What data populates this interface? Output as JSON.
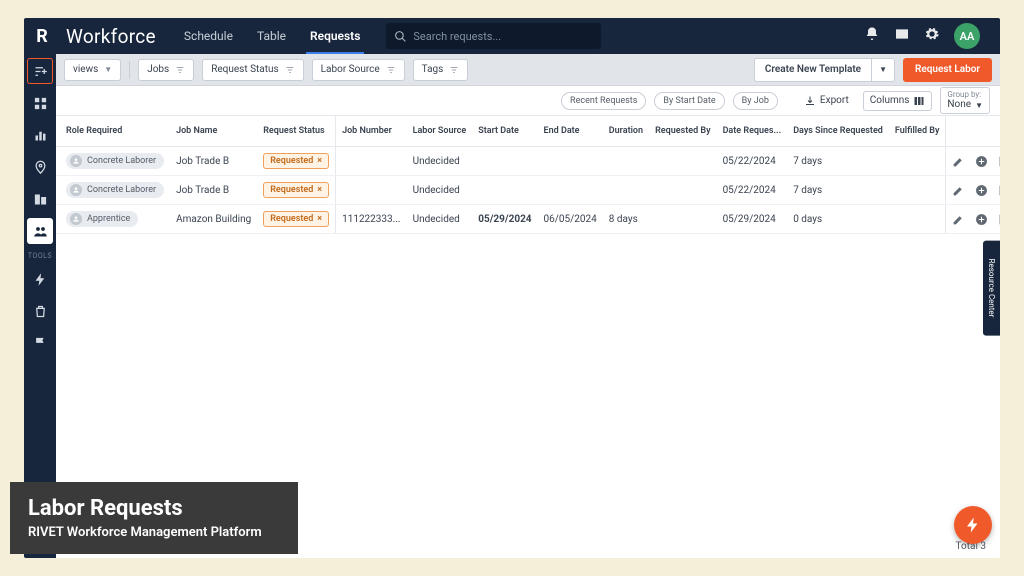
{
  "app": {
    "logo": "R",
    "title": "Workforce",
    "avatar": "AA"
  },
  "tabs": [
    {
      "label": "Schedule"
    },
    {
      "label": "Table"
    },
    {
      "label": "Requests",
      "active": true
    }
  ],
  "search": {
    "placeholder": "Search requests..."
  },
  "filterBar": {
    "views": "views",
    "chips": [
      "Jobs",
      "Request Status",
      "Labor Source",
      "Tags"
    ],
    "createTemplate": "Create New Template",
    "requestLabor": "Request Labor"
  },
  "toolbar": {
    "pills": [
      "Recent Requests",
      "By Start Date",
      "By Job"
    ],
    "export": "Export",
    "columns": "Columns",
    "groupByLabel": "Group by:",
    "groupByValue": "None"
  },
  "columns": [
    "Role Required",
    "Job Name",
    "Request Status",
    "Job Number",
    "Labor Source",
    "Start Date",
    "End Date",
    "Duration",
    "Requested By",
    "Date Reques...",
    "Days Since Requested",
    "Fulfilled By"
  ],
  "rows": [
    {
      "role": "Concrete Laborer",
      "job": "Job Trade B",
      "status": "Requested",
      "number": "",
      "source": "Undecided",
      "start": "",
      "end": "",
      "dur": "",
      "reqBy": "",
      "dateReq": "05/22/2024",
      "days": "7 days",
      "fulfilled": ""
    },
    {
      "role": "Concrete Laborer",
      "job": "Job Trade B",
      "status": "Requested",
      "number": "",
      "source": "Undecided",
      "start": "",
      "end": "",
      "dur": "",
      "reqBy": "",
      "dateReq": "05/22/2024",
      "days": "7 days",
      "fulfilled": ""
    },
    {
      "role": "Apprentice",
      "job": "Amazon Building",
      "status": "Requested",
      "number": "111222333...",
      "source": "Undecided",
      "start": "05/29/2024",
      "startBold": true,
      "end": "06/05/2024",
      "dur": "8 days",
      "reqBy": "",
      "dateReq": "05/29/2024",
      "days": "0 days",
      "fulfilled": ""
    }
  ],
  "footer": {
    "totalLabel": "Total",
    "totalValue": "3"
  },
  "caption": {
    "title": "Labor Requests",
    "sub": "RIVET Workforce Management Platform"
  },
  "sideLabel": "TOOLS",
  "resourceCenter": "Resource Center"
}
